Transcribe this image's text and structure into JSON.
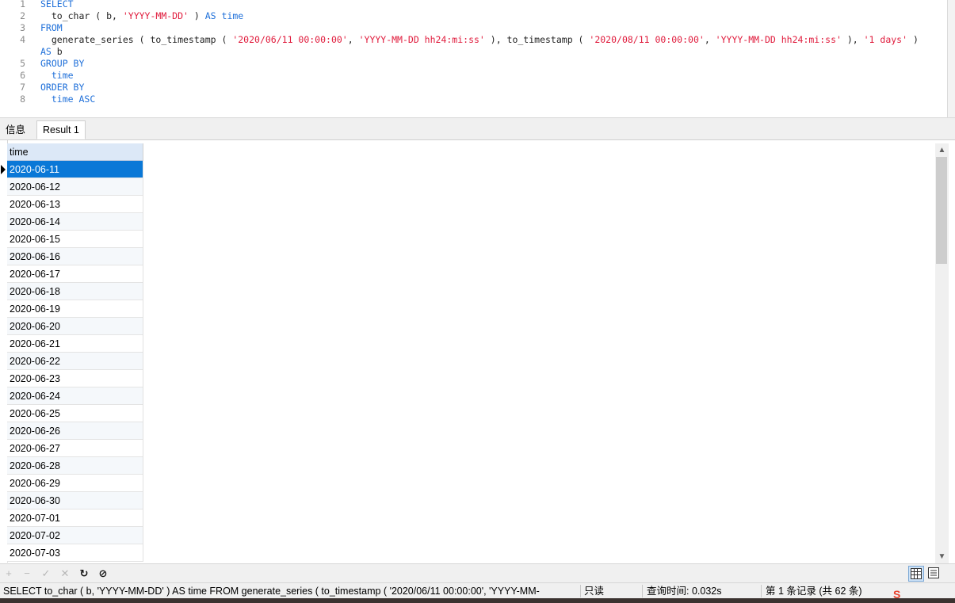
{
  "editor": {
    "lines": [
      {
        "num": "1",
        "tokens": [
          {
            "t": "SELECT",
            "c": "kw"
          }
        ]
      },
      {
        "num": "2",
        "tokens": [
          {
            "t": "  to_char ( b, ",
            "c": ""
          },
          {
            "t": "'YYYY-MM-DD'",
            "c": "str"
          },
          {
            "t": " ) ",
            "c": ""
          },
          {
            "t": "AS",
            "c": "kw"
          },
          {
            "t": " ",
            "c": ""
          },
          {
            "t": "time",
            "c": "kw"
          }
        ]
      },
      {
        "num": "3",
        "tokens": [
          {
            "t": "FROM",
            "c": "kw"
          }
        ]
      },
      {
        "num": "4",
        "tokens": [
          {
            "t": "  generate_series ( to_timestamp ( ",
            "c": ""
          },
          {
            "t": "'2020/06/11 00:00:00'",
            "c": "str"
          },
          {
            "t": ", ",
            "c": ""
          },
          {
            "t": "'YYYY-MM-DD hh24:mi:ss'",
            "c": "str"
          },
          {
            "t": " ), to_timestamp ( ",
            "c": ""
          },
          {
            "t": "'2020/08/11 00:00:00'",
            "c": "str"
          },
          {
            "t": ", ",
            "c": ""
          },
          {
            "t": "'YYYY-MM-DD hh24:mi:ss'",
            "c": "str"
          },
          {
            "t": " ), ",
            "c": ""
          },
          {
            "t": "'1 days'",
            "c": "str"
          },
          {
            "t": " )",
            "c": ""
          }
        ]
      },
      {
        "num": "",
        "tokens": [
          {
            "t": "AS",
            "c": "kw"
          },
          {
            "t": " b",
            "c": ""
          }
        ]
      },
      {
        "num": "5",
        "tokens": [
          {
            "t": "GROUP BY",
            "c": "kw"
          }
        ]
      },
      {
        "num": "6",
        "tokens": [
          {
            "t": "  ",
            "c": ""
          },
          {
            "t": "time",
            "c": "kw"
          }
        ]
      },
      {
        "num": "7",
        "tokens": [
          {
            "t": "ORDER BY",
            "c": "kw"
          }
        ]
      },
      {
        "num": "8",
        "tokens": [
          {
            "t": "  ",
            "c": ""
          },
          {
            "t": "time ASC",
            "c": "kw"
          }
        ]
      }
    ]
  },
  "tabs": {
    "info_label": "信息",
    "result_label": "Result 1"
  },
  "grid": {
    "column_header": "time",
    "rows": [
      "2020-06-11",
      "2020-06-12",
      "2020-06-13",
      "2020-06-14",
      "2020-06-15",
      "2020-06-16",
      "2020-06-17",
      "2020-06-18",
      "2020-06-19",
      "2020-06-20",
      "2020-06-21",
      "2020-06-22",
      "2020-06-23",
      "2020-06-24",
      "2020-06-25",
      "2020-06-26",
      "2020-06-27",
      "2020-06-28",
      "2020-06-29",
      "2020-06-30",
      "2020-07-01",
      "2020-07-02",
      "2020-07-03"
    ],
    "selected_index": 0
  },
  "toolbar": {
    "add_icon": "plus-icon",
    "delete_icon": "minus-icon",
    "apply_icon": "check-icon",
    "discard_icon": "x-icon",
    "refresh_icon": "refresh-icon",
    "stop_icon": "stop-icon",
    "grid_view_icon": "grid-view-icon",
    "form_view_icon": "form-view-icon"
  },
  "status": {
    "query_text": "SELECT    to_char ( b, 'YYYY-MM-DD' ) AS time   FROM      generate_series ( to_timestamp ( '2020/06/11 00:00:00', 'YYYY-MM-",
    "readonly": "只读",
    "query_time": "查询时间: 0.032s",
    "record_info": "第 1 条记录 (共 62 条)"
  },
  "colors": {
    "keyword": "#1e6fd9",
    "string": "#e01b3c",
    "selection": "#0a78d7",
    "header": "#dce8f7"
  }
}
